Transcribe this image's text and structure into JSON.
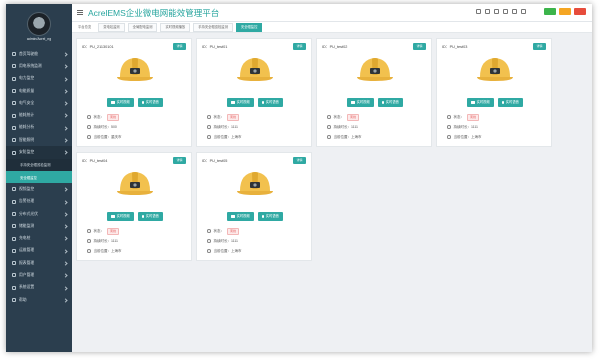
{
  "header": {
    "app_title": "AcrelEMS企业微电网能效管理平台",
    "badge_colors": [
      "#3cb44b",
      "#f5a623",
      "#e74c3c"
    ]
  },
  "sidebar": {
    "username": "admin/Acrel_ng",
    "items": [
      {
        "label": "首页驾驶舱",
        "icon": "home-icon"
      },
      {
        "label": "用电系统监测",
        "icon": "monitor-icon"
      },
      {
        "label": "电力监控",
        "icon": "bolt-icon"
      },
      {
        "label": "电能质量",
        "icon": "wave-icon"
      },
      {
        "label": "电气安全",
        "icon": "shield-icon"
      },
      {
        "label": "能耗统计",
        "icon": "chart-icon"
      },
      {
        "label": "能耗分析",
        "icon": "analysis-icon"
      },
      {
        "label": "智能照明",
        "icon": "light-icon"
      },
      {
        "label": "安防监控",
        "icon": "camera-icon"
      }
    ],
    "sub_items": [
      {
        "label": "手持安全帽巡检监测"
      },
      {
        "label": "安全帽监控"
      }
    ],
    "items_after": [
      {
        "label": "视频监控",
        "icon": "video-icon"
      },
      {
        "label": "告警处理",
        "icon": "alarm-icon"
      },
      {
        "label": "分布式光伏",
        "icon": "solar-icon"
      },
      {
        "label": "储能监测",
        "icon": "battery-icon"
      },
      {
        "label": "充电桩",
        "icon": "charger-icon"
      },
      {
        "label": "运维管理",
        "icon": "wrench-icon"
      },
      {
        "label": "报表管理",
        "icon": "report-icon"
      },
      {
        "label": "用户管理",
        "icon": "user-icon"
      },
      {
        "label": "系统设置",
        "icon": "gear-icon"
      },
      {
        "label": "帮助",
        "icon": "help-icon"
      }
    ]
  },
  "tabs": [
    {
      "label": "平台总览",
      "style": "plain"
    },
    {
      "label": "变电站监测",
      "style": "normal"
    },
    {
      "label": "全局配电监测",
      "style": "normal"
    },
    {
      "label": "实时视频播放",
      "style": "normal"
    },
    {
      "label": "手持安全帽巡检监测",
      "style": "normal"
    },
    {
      "label": "安全帽监控",
      "style": "active"
    }
  ],
  "cards": [
    {
      "id": "ID：PU_21130101",
      "detail": "详情",
      "video_label": "实时视频",
      "talk_label": "实时语音",
      "status_label": "状态：",
      "status": "离线",
      "duration_label": "持续时长：",
      "duration": "500",
      "location_label": "当前位置：",
      "location": "重庆市"
    },
    {
      "id": "ID：PU_test01",
      "detail": "详情",
      "video_label": "实时视频",
      "talk_label": "实时语音",
      "status_label": "状态：",
      "status": "离线",
      "duration_label": "持续时长：",
      "duration": "1111",
      "location_label": "当前位置：",
      "location": "上海市"
    },
    {
      "id": "ID：PU_test02",
      "detail": "详情",
      "video_label": "实时视频",
      "talk_label": "实时语音",
      "status_label": "状态：",
      "status": "离线",
      "duration_label": "持续时长：",
      "duration": "1111",
      "location_label": "当前位置：",
      "location": "上海市"
    },
    {
      "id": "ID：PU_test03",
      "detail": "详情",
      "video_label": "实时视频",
      "talk_label": "实时语音",
      "status_label": "状态：",
      "status": "离线",
      "duration_label": "持续时长：",
      "duration": "1111",
      "location_label": "当前位置：",
      "location": "上海市"
    },
    {
      "id": "ID：PU_test04",
      "detail": "详情",
      "video_label": "实时视频",
      "talk_label": "实时语音",
      "status_label": "状态：",
      "status": "离线",
      "duration_label": "持续时长：",
      "duration": "1111",
      "location_label": "当前位置：",
      "location": "上海市"
    },
    {
      "id": "ID：PU_test05",
      "detail": "详情",
      "video_label": "实时视频",
      "talk_label": "实时语音",
      "status_label": "状态：",
      "status": "离线",
      "duration_label": "持续时长：",
      "duration": "1111",
      "location_label": "当前位置：",
      "location": "上海市"
    }
  ],
  "colors": {
    "accent": "#2fa9a3",
    "sidebar_bg": "#2b3e4e",
    "helmet": "#f2c14e"
  }
}
